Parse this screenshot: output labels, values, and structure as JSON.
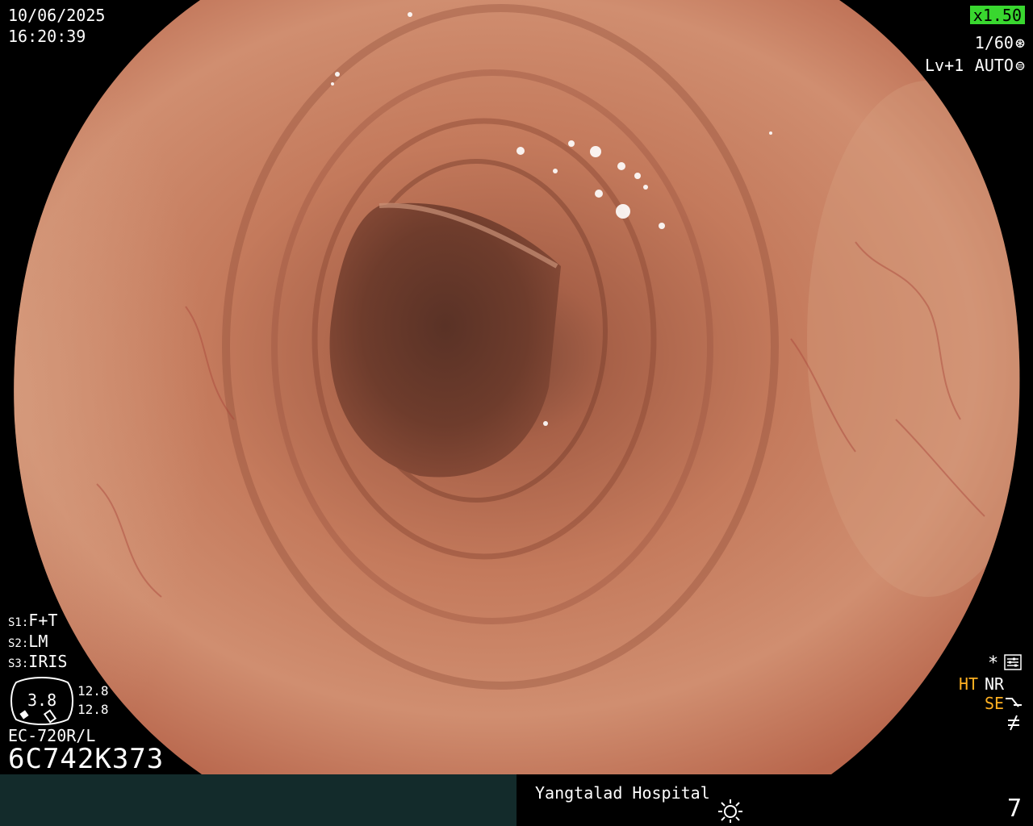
{
  "header": {
    "date": "10/06/2025",
    "time": "16:20:39",
    "zoom": "x1.50",
    "shutter": "1/60",
    "shutter_icon": "aperture-icon",
    "level": "Lv+1",
    "mode": "AUTO",
    "mode_icon": "iris-icon"
  },
  "setup": {
    "s1_key": "S1:",
    "s1_value": "F+T",
    "s2_key": "S2:",
    "s2_value": "LM",
    "s3_key": "S3:",
    "s3_value": "IRIS",
    "gauge_value": "3.8",
    "gauge_top": "12.8",
    "gauge_bottom": "12.8"
  },
  "scope": {
    "model": "EC-720R/L",
    "serial": "6C742K373"
  },
  "indicators": {
    "asterisk": "*",
    "menu_icon": "settings-menu-icon",
    "ht": "HT",
    "nr": "NR",
    "se": "SE",
    "se_icon": "structure-enhance-icon",
    "freeze_icon": "freeze-icon"
  },
  "status_bar": {
    "hospital": "Yangtalad Hospital",
    "light_icon": "light-source-icon",
    "image_count": "7"
  },
  "colors": {
    "zoom_badge": "#39d72f",
    "highlight_text": "#ffb021",
    "status_bar_left": "#132b2b",
    "mucosa": "#c7785e"
  }
}
